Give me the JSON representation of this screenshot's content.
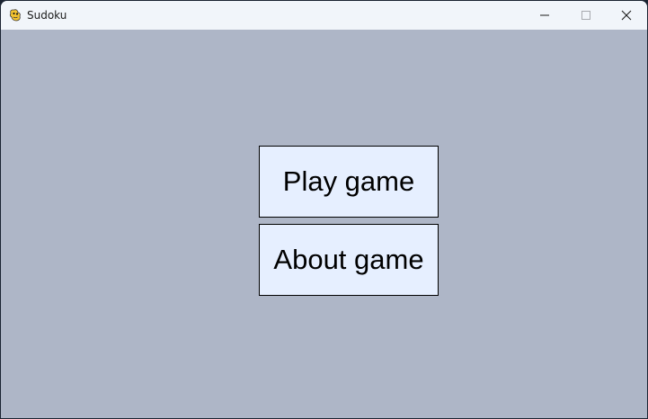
{
  "window": {
    "title": "Sudoku",
    "app_icon": "pygame-snake-icon",
    "controls": {
      "minimize_icon": "minimize-icon",
      "maximize_icon": "maximize-icon",
      "close_icon": "close-icon"
    }
  },
  "menu": {
    "play_label": "Play game",
    "about_label": "About game"
  },
  "colors": {
    "titlebar": "#f1f5fa",
    "background": "#aeb6c7",
    "button_fill": "#e6efff",
    "button_border": "#000000",
    "text": "#000000"
  }
}
